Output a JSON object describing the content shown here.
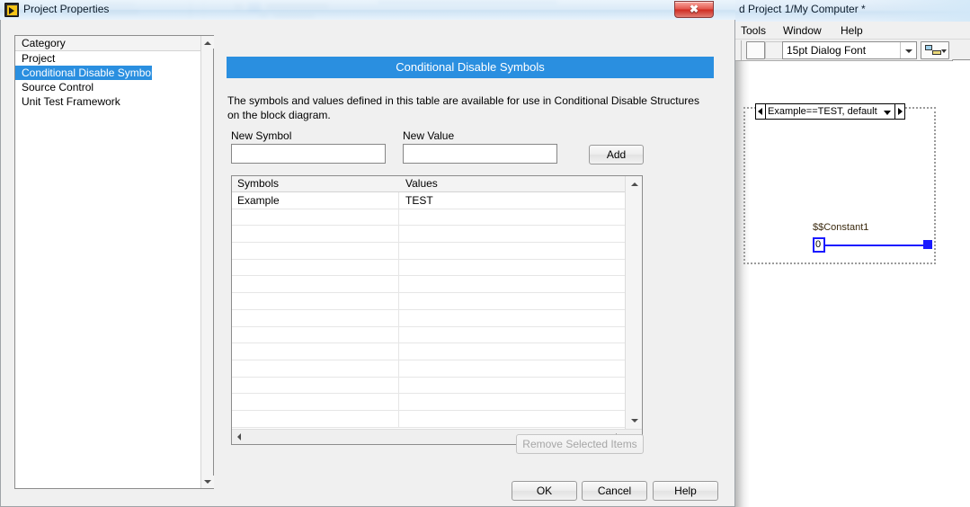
{
  "dialog": {
    "title": "Project Properties",
    "icon": "labview-project-icon",
    "close_label": "✖",
    "category": {
      "header": "Category",
      "items": [
        {
          "label": "Project",
          "selected": false
        },
        {
          "label": "Conditional Disable Symbols",
          "selected": true
        },
        {
          "label": "Source Control",
          "selected": false
        },
        {
          "label": "Unit Test Framework",
          "selected": false
        }
      ]
    },
    "pane": {
      "title": "Conditional Disable Symbols",
      "description": "The symbols and values defined in this table are available for use in Conditional Disable Structures on the block diagram.",
      "new_symbol_label": "New Symbol",
      "new_symbol_value": "",
      "new_symbol_placeholder": "",
      "new_value_label": "New Value",
      "new_value_value": "",
      "new_value_placeholder": "",
      "add_label": "Add",
      "table": {
        "columns": [
          "Symbols",
          "Values"
        ],
        "rows": [
          {
            "symbol": "Example",
            "value": "TEST"
          },
          {
            "symbol": "",
            "value": ""
          },
          {
            "symbol": "",
            "value": ""
          },
          {
            "symbol": "",
            "value": ""
          },
          {
            "symbol": "",
            "value": ""
          },
          {
            "symbol": "",
            "value": ""
          },
          {
            "symbol": "",
            "value": ""
          },
          {
            "symbol": "",
            "value": ""
          },
          {
            "symbol": "",
            "value": ""
          },
          {
            "symbol": "",
            "value": ""
          },
          {
            "symbol": "",
            "value": ""
          },
          {
            "symbol": "",
            "value": ""
          },
          {
            "symbol": "",
            "value": ""
          },
          {
            "symbol": "",
            "value": ""
          }
        ]
      },
      "remove_label": "Remove Selected Items"
    },
    "buttons": {
      "ok": "OK",
      "cancel": "Cancel",
      "help": "Help"
    }
  },
  "background_window": {
    "title": "d Project 1/My Computer *",
    "menus": [
      {
        "label": "Tools",
        "mnemonic": "T"
      },
      {
        "label": "Window",
        "mnemonic": "W"
      },
      {
        "label": "Help",
        "mnemonic": "H"
      }
    ],
    "toolbar": {
      "font_selector": "15pt Dialog Font"
    },
    "diagram": {
      "structure_selector": "Example==TEST, default",
      "constant_label": "$$Constant1",
      "constant_value": "0"
    }
  },
  "colors": {
    "accent": "#2a8fe0",
    "wire": "#1a1aff",
    "dialog_bg": "#f0f0f0",
    "close_button": "#cf2b22"
  }
}
